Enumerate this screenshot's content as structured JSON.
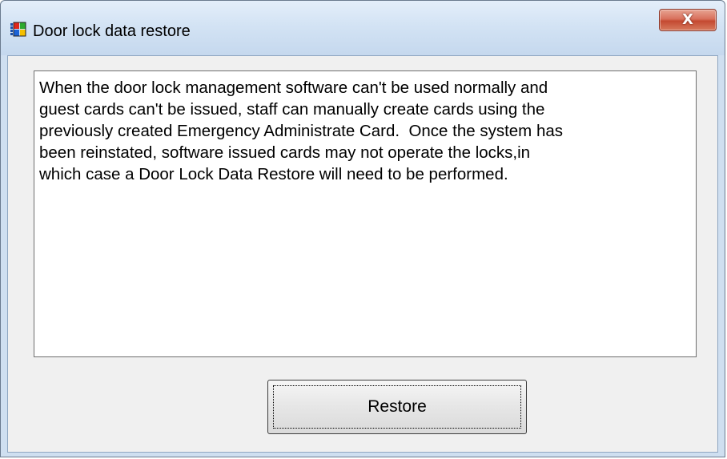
{
  "window": {
    "title": "Door lock data restore",
    "icon": "door-lock-app-icon",
    "close_glyph": "X"
  },
  "message": {
    "text": "When the door lock management software can't be used normally and\nguest cards can't be issued, staff can manually create cards using the\npreviously created Emergency Administrate Card.  Once the system has\nbeen reinstated, software issued cards may not operate the locks,in\nwhich case a Door Lock Data Restore will need to be performed."
  },
  "buttons": {
    "restore_label": "Restore"
  },
  "colors": {
    "close_button": "#c44a31",
    "titlebar": "#d3e3f4",
    "client_background": "#f0f0f0"
  }
}
